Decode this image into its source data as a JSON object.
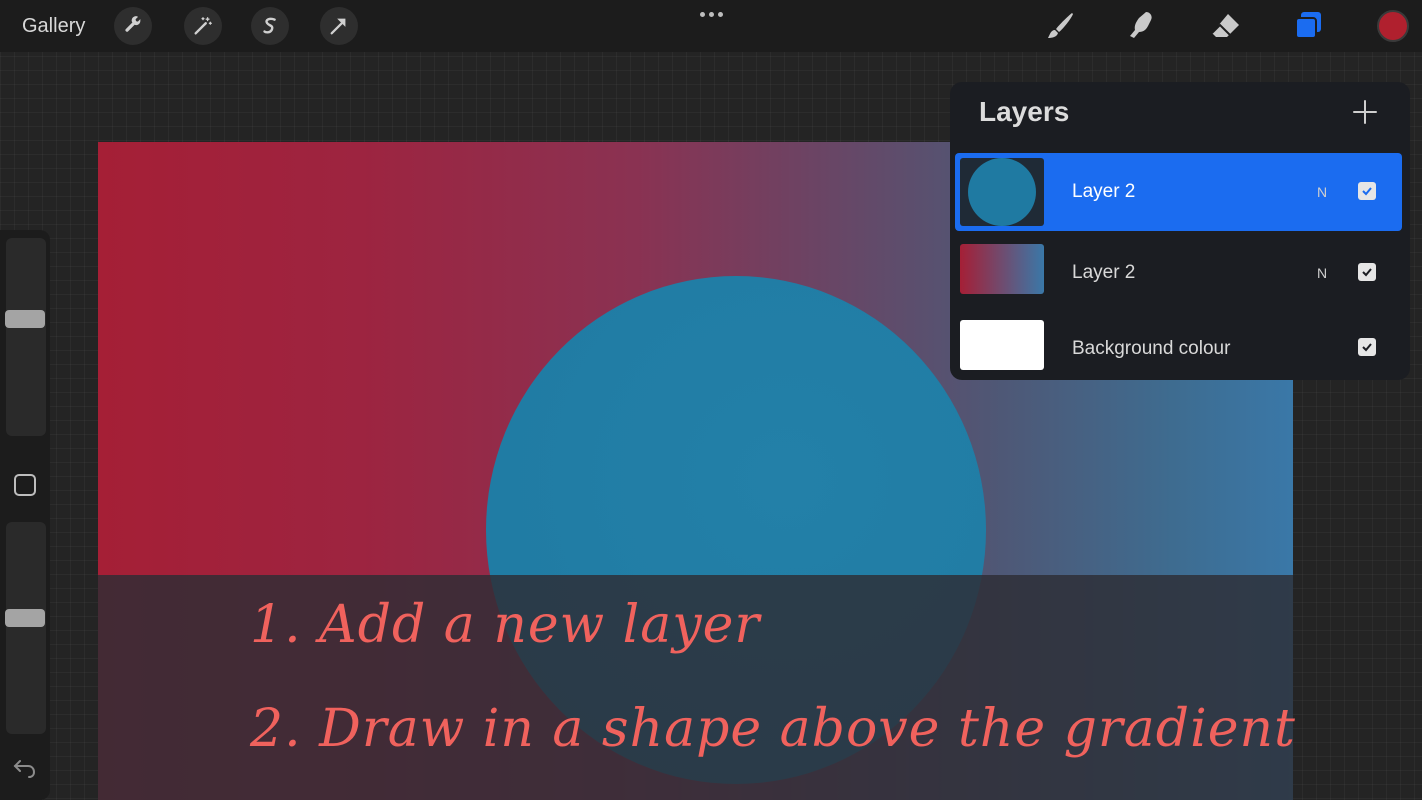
{
  "topbar": {
    "gallery_label": "Gallery",
    "tools": [
      {
        "icon": "wrench-icon"
      },
      {
        "icon": "magic-wand-icon"
      },
      {
        "icon": "selection-s-icon"
      },
      {
        "icon": "transform-arrow-icon"
      }
    ],
    "right_tools": [
      "brush-icon",
      "smudge-icon",
      "eraser-icon",
      "layers-icon"
    ],
    "current_color": "#b0202e"
  },
  "layers_panel": {
    "title": "Layers",
    "layers": [
      {
        "name": "Layer 2",
        "blend": "N",
        "visible": true,
        "active": true
      },
      {
        "name": "Layer 2",
        "blend": "N",
        "visible": true,
        "active": false
      },
      {
        "name": "Background colour",
        "blend": "",
        "visible": true,
        "active": false
      }
    ]
  },
  "sidebar": {
    "brush_size_level": 0.6,
    "opacity_level": 0.55
  },
  "canvas": {
    "gradient_start": "#a51f36",
    "gradient_end": "#3a78a8",
    "circle_color": "#1f7aa2"
  },
  "annotation": {
    "step1": "1. Add a new layer",
    "step2": "2. Draw in a shape above the gradient"
  }
}
